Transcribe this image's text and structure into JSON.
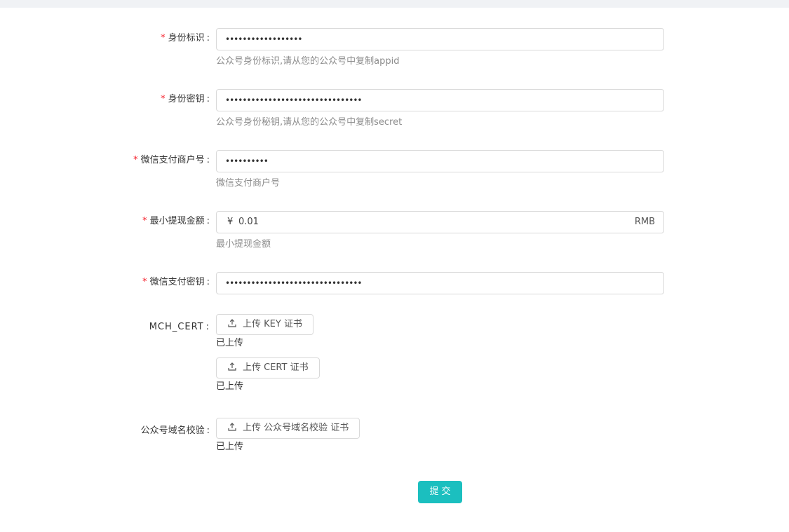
{
  "form": {
    "appid": {
      "label": "身份标识",
      "value": "••••••••••••••••••",
      "help": "公众号身份标识,请从您的公众号中复制appid"
    },
    "secret": {
      "label": "身份密钥",
      "value": "••••••••••••••••••••••••••••••••",
      "help": "公众号身份秘钥,请从您的公众号中复制secret"
    },
    "mch_id": {
      "label": "微信支付商户号",
      "value": "••••••••••",
      "help": "微信支付商户号"
    },
    "min_withdraw": {
      "label": "最小提现金额",
      "prefix": "¥",
      "value": "0.01",
      "suffix": "RMB",
      "help": "最小提现金额"
    },
    "pay_key": {
      "label": "微信支付密钥",
      "value": "••••••••••••••••••••••••••••••••"
    },
    "mch_cert": {
      "label": "MCH_CERT",
      "key_button": "上传 KEY 证书",
      "key_status": "已上传",
      "cert_button": "上传 CERT 证书",
      "cert_status": "已上传"
    },
    "domain_verify": {
      "label": "公众号域名校验",
      "button": "上传 公众号域名校验 证书",
      "status": "已上传"
    },
    "required_mark": "*",
    "colon": ":",
    "submit_label": "提交"
  },
  "icons": {
    "upload": "upload-icon"
  },
  "colors": {
    "primary": "#1bbfbf",
    "required": "#f5222d",
    "help_text": "#8c8c8c",
    "border": "#d9d9d9",
    "topbar": "#f0f2f5"
  }
}
